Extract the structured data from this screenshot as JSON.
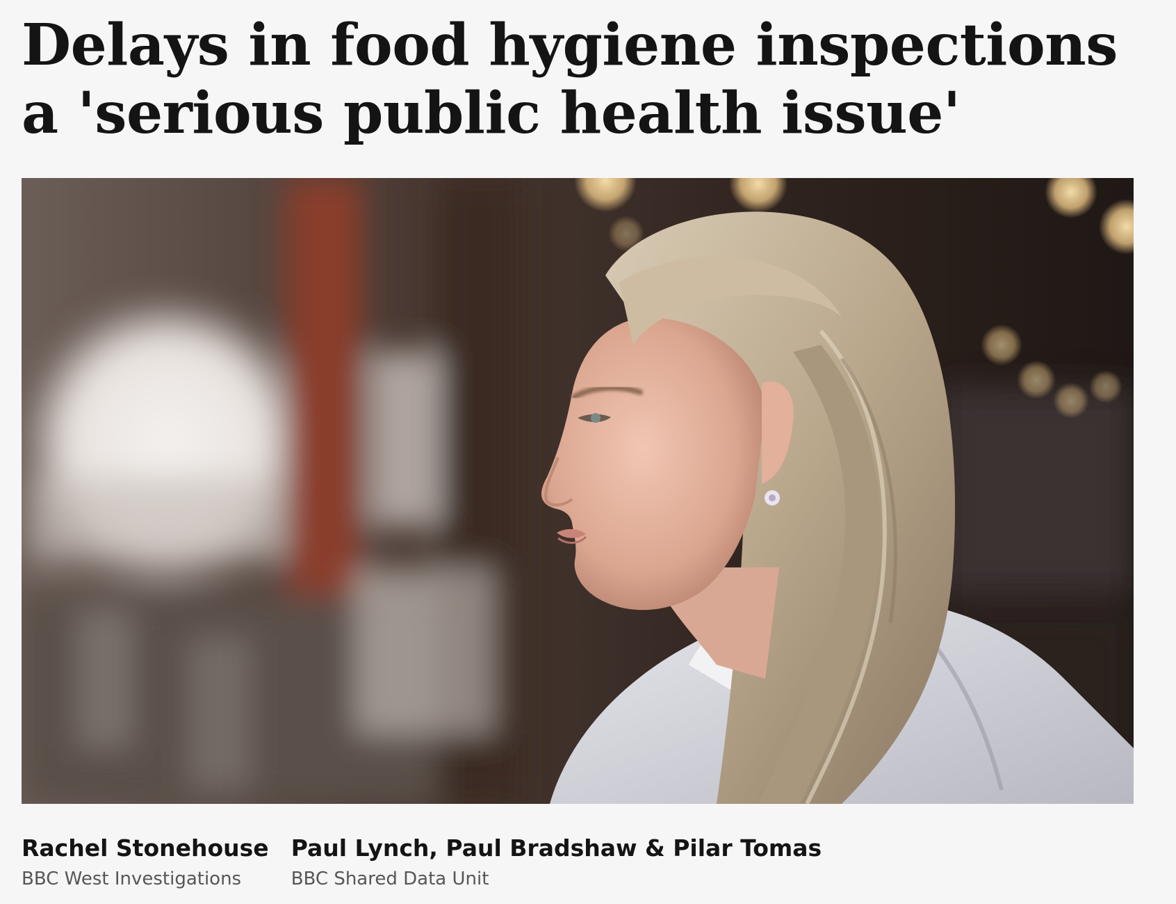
{
  "article": {
    "headline": "Delays in food hygiene inspections a 'serious public health issue'",
    "hero_image": {
      "subject": "woman-profile-photo"
    },
    "bylines": [
      {
        "name": "Rachel Stonehouse",
        "department": "BBC West Investigations"
      },
      {
        "name": "Paul Lynch, Paul Bradshaw & Pilar Tomas",
        "department": "BBC Shared Data Unit"
      }
    ]
  },
  "colors": {
    "background": "#f6f6f6",
    "headline": "#141414",
    "byline_name": "#141414",
    "byline_department": "#545658"
  }
}
